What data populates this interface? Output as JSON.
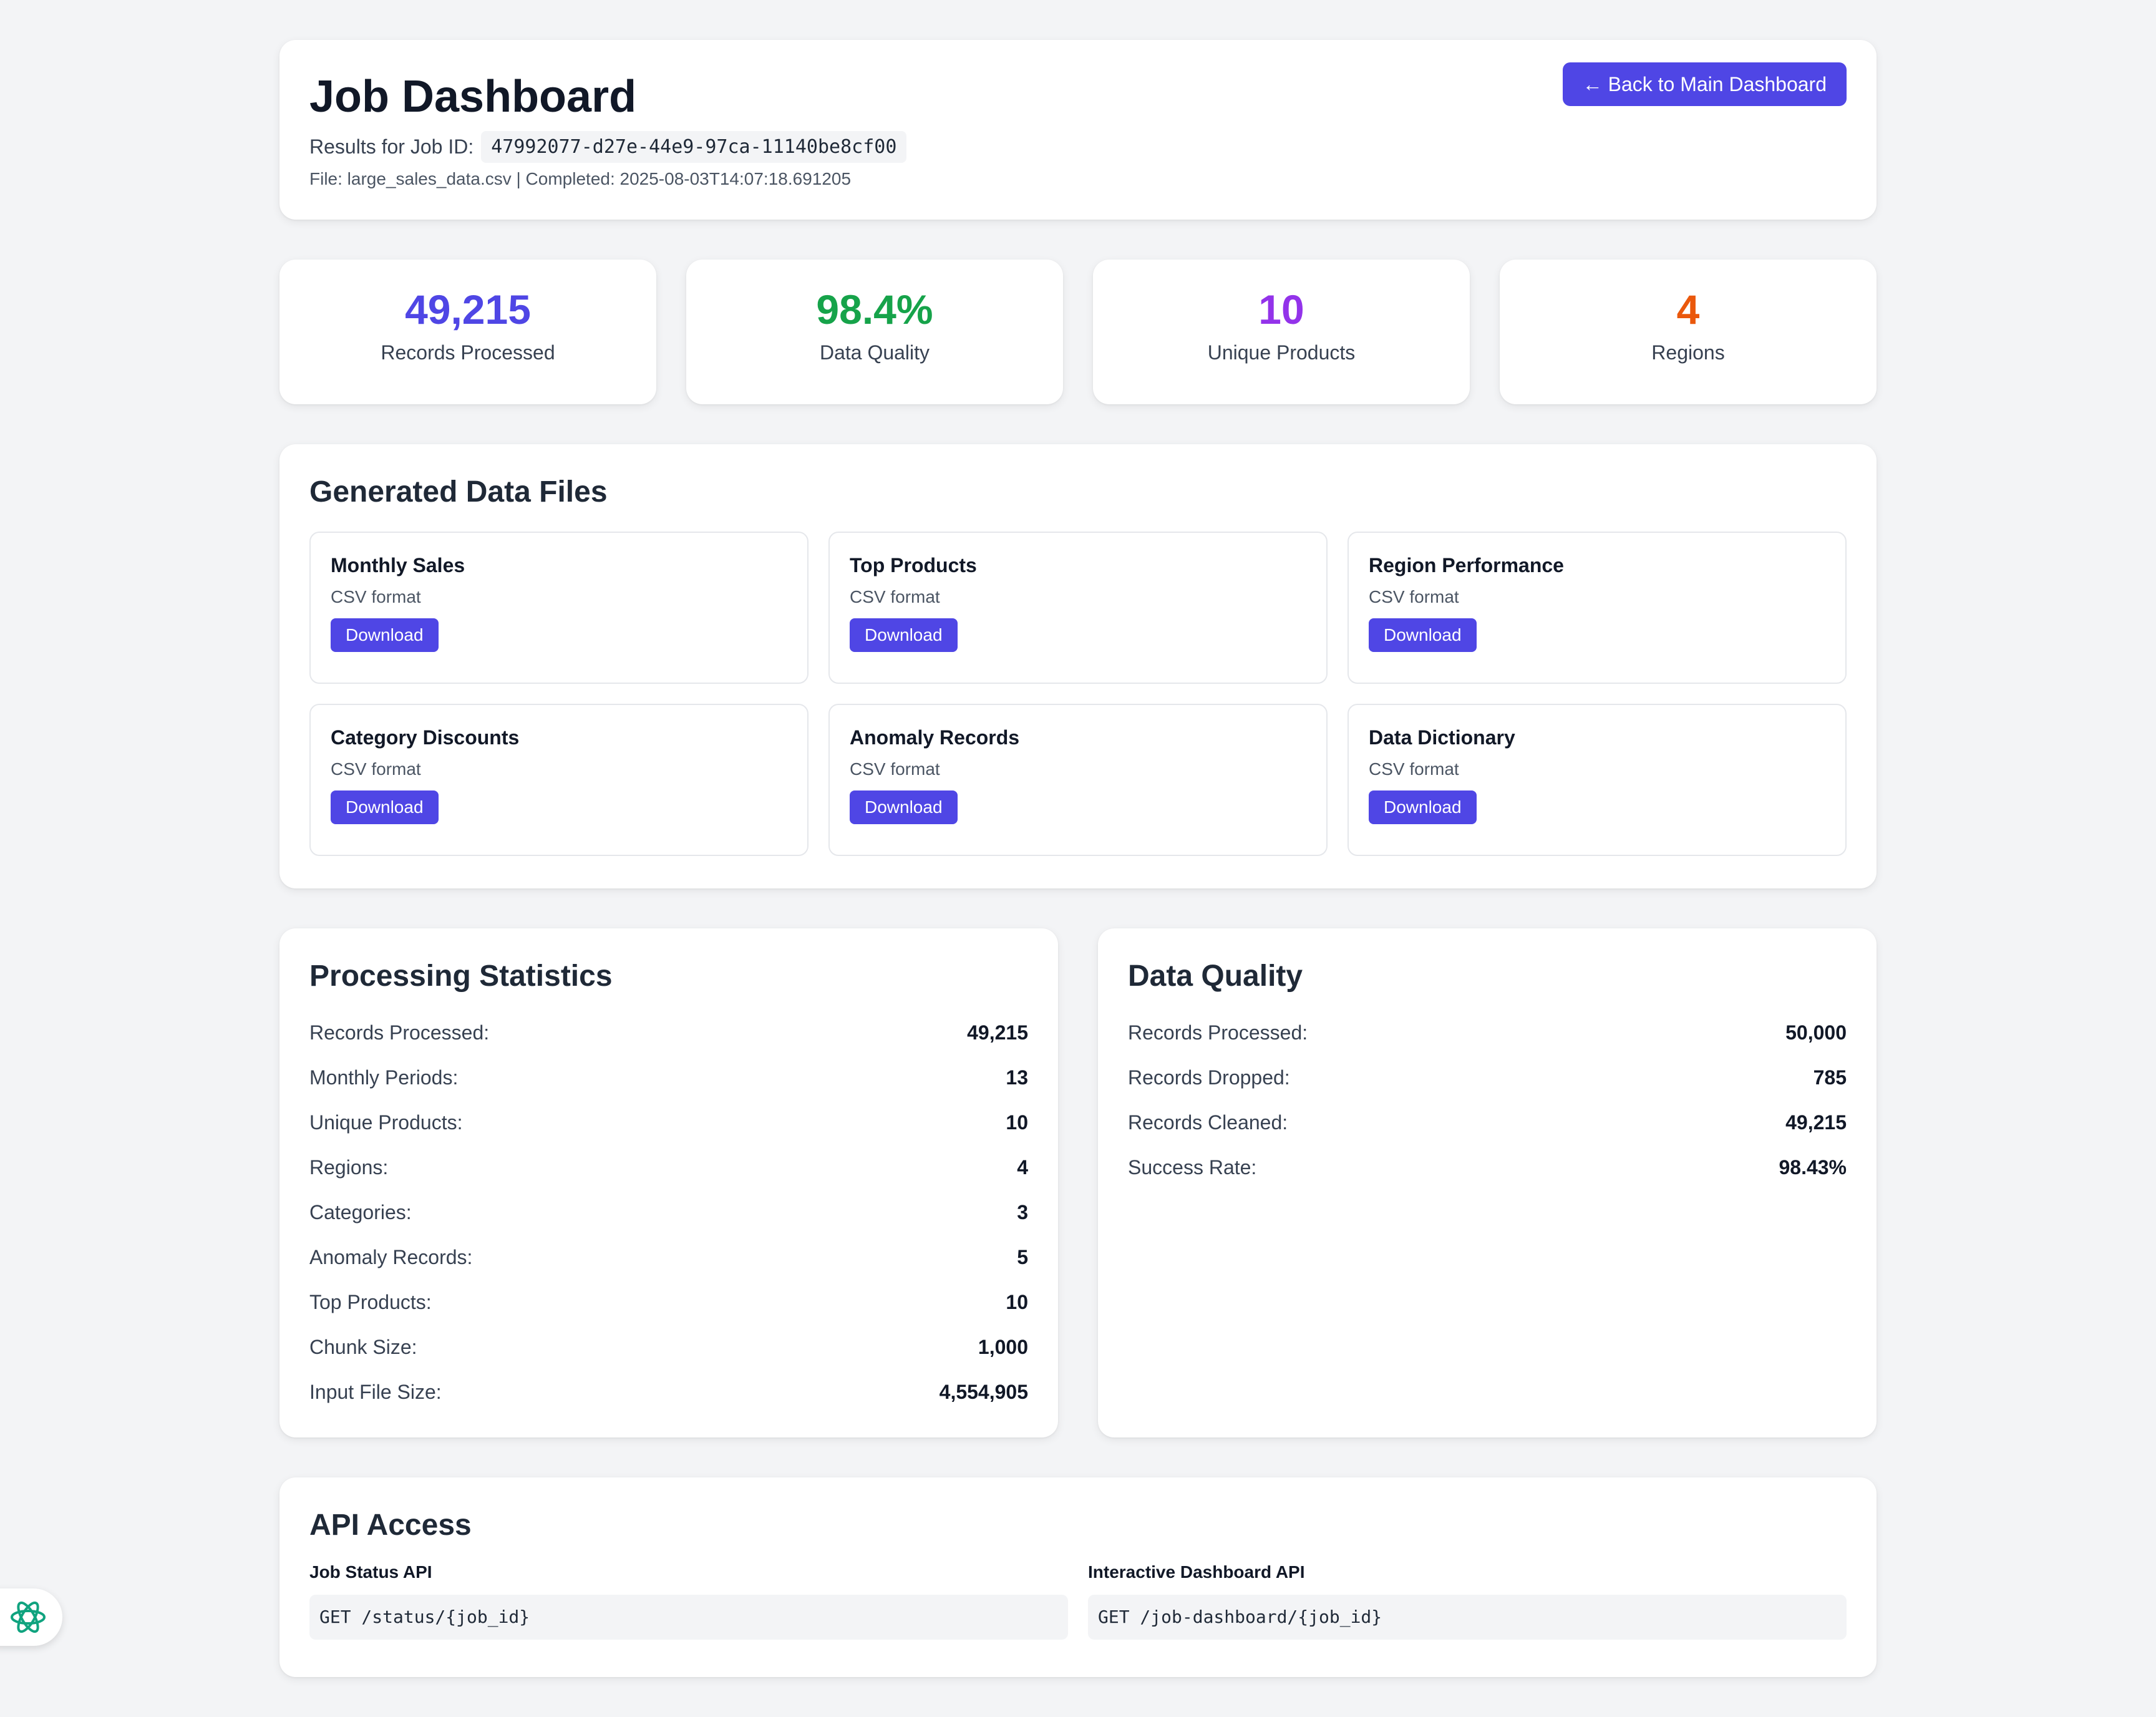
{
  "header": {
    "title": "Job Dashboard",
    "job_id_label": "Results for Job ID:",
    "job_id": "47992077-d27e-44e9-97ca-11140be8cf00",
    "file_line": "File: large_sales_data.csv | Completed: 2025-08-03T14:07:18.691205",
    "back_button": "← Back to Main Dashboard"
  },
  "stats": [
    {
      "value": "49,215",
      "label": "Records Processed",
      "color": "#4f46e5"
    },
    {
      "value": "98.4%",
      "label": "Data Quality",
      "color": "#16a34a"
    },
    {
      "value": "10",
      "label": "Unique Products",
      "color": "#9333ea"
    },
    {
      "value": "4",
      "label": "Regions",
      "color": "#ea580c"
    }
  ],
  "files": {
    "title": "Generated Data Files",
    "items": [
      {
        "name": "Monthly Sales",
        "format": "CSV format",
        "button": "Download"
      },
      {
        "name": "Top Products",
        "format": "CSV format",
        "button": "Download"
      },
      {
        "name": "Region Performance",
        "format": "CSV format",
        "button": "Download"
      },
      {
        "name": "Category Discounts",
        "format": "CSV format",
        "button": "Download"
      },
      {
        "name": "Anomaly Records",
        "format": "CSV format",
        "button": "Download"
      },
      {
        "name": "Data Dictionary",
        "format": "CSV format",
        "button": "Download"
      }
    ]
  },
  "processing": {
    "title": "Processing Statistics",
    "rows": [
      {
        "k": "Records Processed:",
        "v": "49,215"
      },
      {
        "k": "Monthly Periods:",
        "v": "13"
      },
      {
        "k": "Unique Products:",
        "v": "10"
      },
      {
        "k": "Regions:",
        "v": "4"
      },
      {
        "k": "Categories:",
        "v": "3"
      },
      {
        "k": "Anomaly Records:",
        "v": "5"
      },
      {
        "k": "Top Products:",
        "v": "10"
      },
      {
        "k": "Chunk Size:",
        "v": "1,000"
      },
      {
        "k": "Input File Size:",
        "v": "4,554,905"
      }
    ]
  },
  "quality": {
    "title": "Data Quality",
    "rows": [
      {
        "k": "Records Processed:",
        "v": "50,000"
      },
      {
        "k": "Records Dropped:",
        "v": "785"
      },
      {
        "k": "Records Cleaned:",
        "v": "49,215"
      },
      {
        "k": "Success Rate:",
        "v": "98.43%"
      }
    ]
  },
  "api": {
    "title": "API Access",
    "items": [
      {
        "label": "Job Status API",
        "code": "GET /status/{job_id}"
      },
      {
        "label": "Interactive Dashboard API",
        "code": "GET /job-dashboard/{job_id}"
      }
    ]
  },
  "widget": {
    "icon": "openai-logo-icon",
    "color": "#10a37f"
  }
}
